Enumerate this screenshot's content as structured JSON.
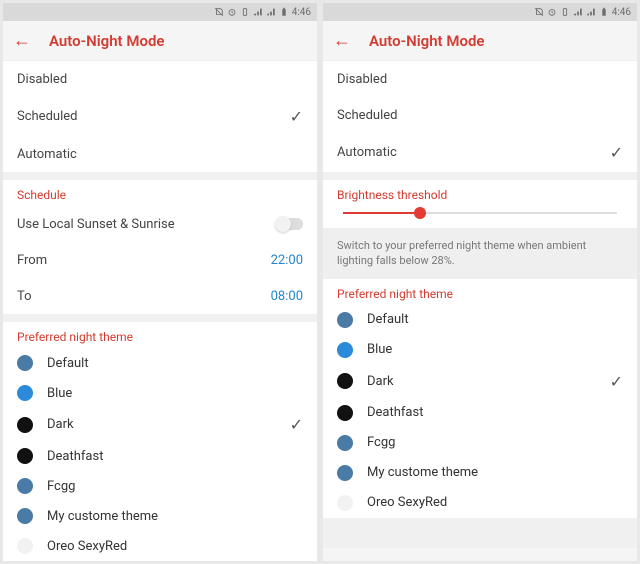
{
  "status": {
    "time": "4:46"
  },
  "title": "Auto-Night Mode",
  "modes": {
    "disabled": "Disabled",
    "scheduled": "Scheduled",
    "automatic": "Automatic"
  },
  "left": {
    "selected_mode": "Scheduled",
    "schedule_header": "Schedule",
    "local_sunset": "Use Local Sunset & Sunrise",
    "from_label": "From",
    "from_value": "22:00",
    "to_label": "To",
    "to_value": "08:00",
    "selected_theme": "Dark"
  },
  "right": {
    "selected_mode": "Automatic",
    "brightness_header": "Brightness threshold",
    "slider_percent": 28,
    "hint": "Switch to your preferred night theme when ambient lighting falls below 28%.",
    "selected_theme": "Dark"
  },
  "theme_header": "Preferred night theme",
  "themes": [
    {
      "name": "Default",
      "color": "#4a7ba6"
    },
    {
      "name": "Blue",
      "color": "#2b8ad9"
    },
    {
      "name": "Dark",
      "color": "#111111"
    },
    {
      "name": "Deathfast",
      "color": "#111111"
    },
    {
      "name": "Fcgg",
      "color": "#4a7ba6"
    },
    {
      "name": "My custome theme",
      "color": "#4a7ba6"
    },
    {
      "name": "Oreo SexyRed",
      "color": "#f2f2f2"
    }
  ]
}
